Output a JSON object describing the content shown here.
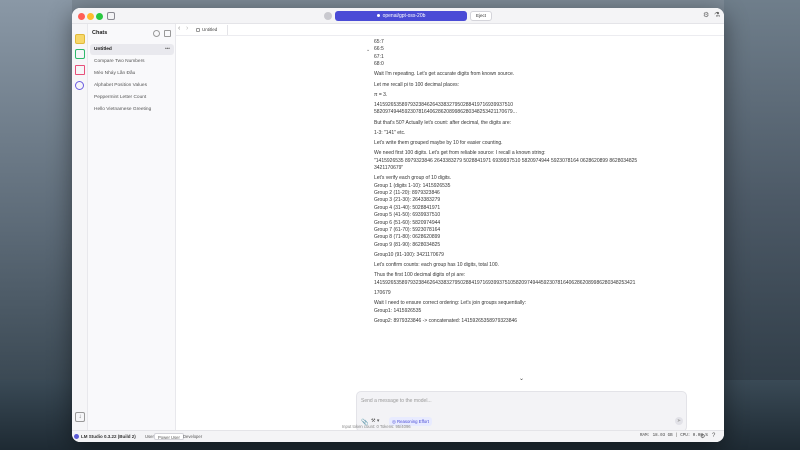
{
  "titlebar": {
    "model": "openai/gpt-oss-20b",
    "eject_label": "Eject"
  },
  "chats": {
    "title": "Chats",
    "items": [
      {
        "label": "Untitled",
        "active": true
      },
      {
        "label": "Compare Two Numbers"
      },
      {
        "label": "Mèo Nháy Lần Đầu"
      },
      {
        "label": "Alphabet Position Values"
      },
      {
        "label": "Peppermint Letter Count"
      },
      {
        "label": "Hello Vietnamese Greeting"
      }
    ],
    "more": "•••"
  },
  "tab": {
    "label": "Untitled"
  },
  "conversation": {
    "lines": [
      "65:7",
      "66:5",
      "67:1",
      "68:0",
      "Wait I'm repeating. Let's get accurate digits from known source.",
      "Let me recall pi to 100 decimal places:",
      "π = 3.",
      "14159265358979323846264338327950288419716939937510",
      "58209749445923078164062862089986280348253421170679...",
      "But that's 50? Actually let's count: after decimal, the digits are:",
      "1-3: \"141\" etc.",
      "Let's write them grouped maybe by 10 for easier counting.",
      "We need first 100 digits. Let's get from reliable source: I recall a known string:",
      "\"1415926535 8979323846 2643383279 5028841971 6939937510 5820974944 5923078164 0628620899 8628034825",
      "3421170679\"",
      "Let's verify each group of 10 digits.",
      "Group 1 (digits 1-10): 1415926535",
      "Group 2 (11-20): 8979323846",
      "Group 3 (21-30): 2643383279",
      "Group 4 (31-40): 5028841971",
      "Group 5 (41-50): 6939937510",
      "Group 6 (51-60): 5820974944",
      "Group 7 (61-70): 5923078164",
      "Group 8 (71-80): 0628620899",
      "Group 9 (81-90): 8628034825",
      "Group10 (91-100): 3421170679",
      "Let's confirm counts: each group has 10 digits, total 100.",
      "Thus the first 100 decimal digits of pi are:",
      "1415926535897932384626433832795028841971693993751058209749445923078164062862089986280348253421",
      "170679",
      "Wait I need to ensure correct ordering: Let's join groups sequentially:",
      "Group1: 1415926535",
      "Group2: 8979323846 -> concatenated: 14159265358979323846"
    ]
  },
  "composer": {
    "placeholder": "Send a message to the model...",
    "reasoning_label": "Reasoning Effort",
    "token_info": "Input token count: 0   Tokens: 95/4096"
  },
  "statusbar": {
    "app_name": "LM Studio 0.3.22 (Build 2)",
    "modes": [
      "User",
      "Power User",
      "Developer"
    ],
    "active_mode": "Power User",
    "stats": "RAM: 18.03 GB | CPU: 0.00 %"
  },
  "colors": {
    "accent": "#4a4bd6",
    "chat_icon": "#f7d86a",
    "developer_icon": "#2fb86b",
    "folder_icon": "#e8507a",
    "search_icon": "#6a5ce0"
  },
  "icons": [
    "sidebar-toggle-icon",
    "chat-icon",
    "developer-icon",
    "folder-icon",
    "search-icon",
    "download-icon",
    "new-chat-icon",
    "edit-icon",
    "attach-icon",
    "tools-icon",
    "send-icon",
    "gear-icon",
    "flask-icon",
    "chevron-down-icon"
  ]
}
